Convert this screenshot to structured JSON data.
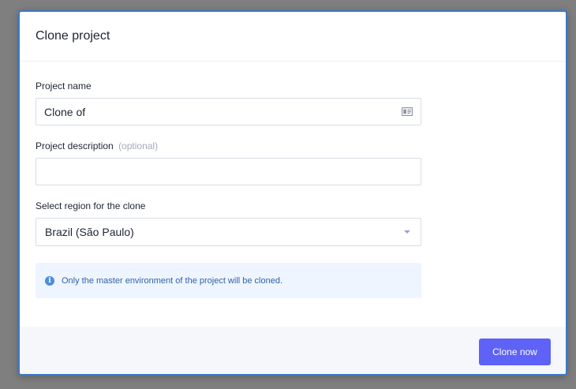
{
  "modal": {
    "title": "Clone project"
  },
  "fields": {
    "name": {
      "label": "Project name",
      "value": "Clone of",
      "icon": "contact-card-icon"
    },
    "description": {
      "label": "Project description",
      "optional": "(optional)",
      "value": "",
      "placeholder": ""
    },
    "region": {
      "label": "Select region for the clone",
      "selected": "Brazil (São Paulo)",
      "icon": "chevron-down-icon"
    }
  },
  "info": {
    "icon": "info-icon",
    "text": "Only the master environment of the project will be cloned."
  },
  "footer": {
    "submit_label": "Clone now"
  },
  "colors": {
    "accent": "#5e62f7",
    "modal_border": "#3a78c9",
    "info_background": "#eef5ff",
    "info_text": "#3360a8"
  }
}
